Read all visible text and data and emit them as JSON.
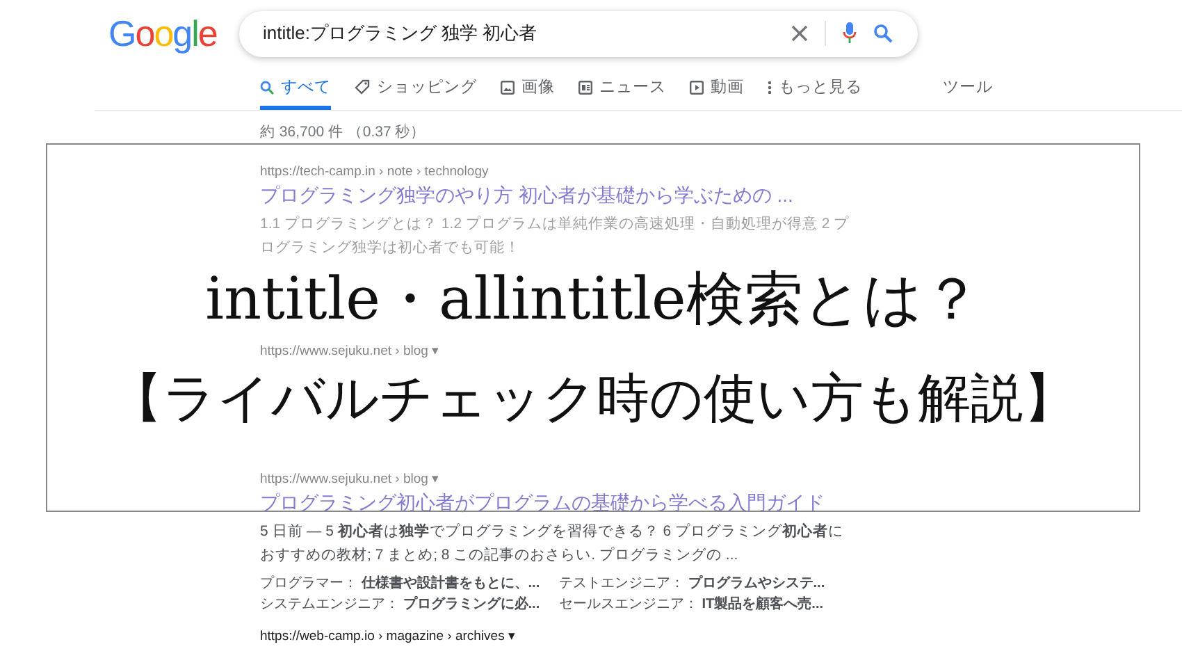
{
  "logo": "Google",
  "search": {
    "query": "intitle:プログラミング 独学 初心者"
  },
  "tabs": [
    {
      "label": "すべて",
      "kind": "search",
      "selected": true
    },
    {
      "label": "ショッピング",
      "kind": "tag",
      "selected": false
    },
    {
      "label": "画像",
      "kind": "image",
      "selected": false
    },
    {
      "label": "ニュース",
      "kind": "news",
      "selected": false
    },
    {
      "label": "動画",
      "kind": "video",
      "selected": false
    },
    {
      "label": "もっと見る",
      "kind": "more",
      "selected": false
    }
  ],
  "tools": "ツール",
  "result_stats": "約 36,700 件 （0.37 秒）",
  "results": [
    {
      "url": "https://tech-camp.in › note › technology",
      "title": "プログラミング独学のやり方 初心者が基礎から学ぶための ...",
      "snippet": "1.1 プログラミングとは？ 1.2 プログラムは単純作業の高速処理・自動処理が得意 2 プログラミング独学は初心者でも可能！"
    },
    {
      "url": "https://www.sejuku.net › blog ▾"
    },
    {
      "url": "https://www.sejuku.net › blog ▾",
      "title": "プログラミング初心者がプログラムの基礎から学べる入門ガイド",
      "snippet": "5 日前 — 5 **初心者**は**独学**でプログラミングを習得できる？ 6 プログラミング**初心者**におすすめの教材; 7 まとめ; 8 この記事のおさらい. プログラミングの ...",
      "sitelinks": [
        "プログラマー： **仕様書や設計書をもとに、...**",
        "テストエンジニア： **プログラムやシステ...**",
        "システムエンジニア： **プログラミングに必...**",
        "セールスエンジニア： **IT製品を顧客へ売...**"
      ]
    },
    {
      "url": "https://web-camp.io › magazine › archives ▾"
    }
  ],
  "overlay": {
    "title": "intitle・allintitle検索とは？",
    "subtitle": "【ライバルチェック時の使い方も解説】"
  }
}
